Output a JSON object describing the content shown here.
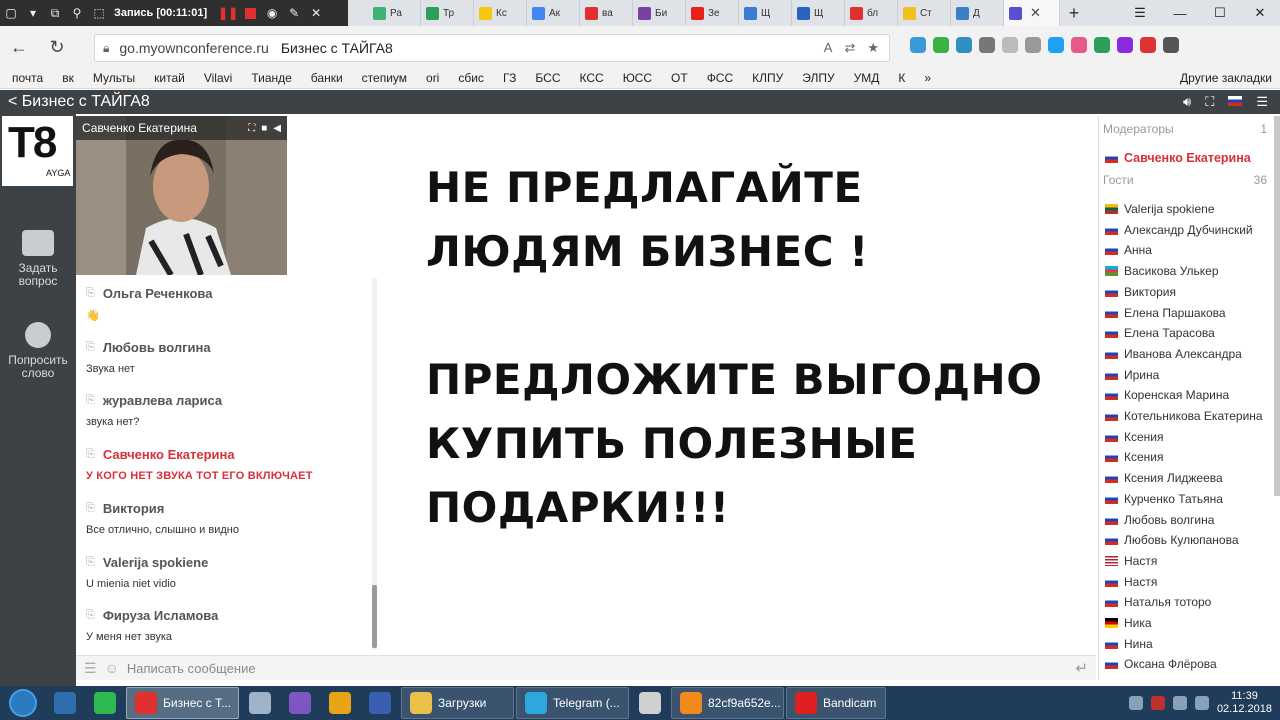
{
  "recorder": {
    "title": "Запись [00:11:01]"
  },
  "browser": {
    "tabs": [
      {
        "label": "Ра",
        "color": "#3cb371"
      },
      {
        "label": "Тр",
        "color": "#2e9e5b"
      },
      {
        "label": "Кс",
        "color": "#f2c811"
      },
      {
        "label": "Ак",
        "color": "#4285f4"
      },
      {
        "label": "ва",
        "color": "#e03030"
      },
      {
        "label": "Би",
        "color": "#7b3fa0"
      },
      {
        "label": "Зе",
        "color": "#e62117"
      },
      {
        "label": "Щ",
        "color": "#3a7bd5"
      },
      {
        "label": "Щ",
        "color": "#2a62c0"
      },
      {
        "label": "бл",
        "color": "#e03030"
      },
      {
        "label": "Ст",
        "color": "#f0c020"
      },
      {
        "label": "Д",
        "color": "#3a80c8"
      }
    ],
    "url_host": "go.myownconference.ru",
    "url_title": "Бизнес с ТАЙГА8",
    "bookmarks": [
      "почта",
      "вк",
      "Мульты",
      "китай",
      "Vilavi",
      "Тианде",
      "банки",
      "степиум",
      "ori",
      "сбис",
      "ГЗ",
      "БСС",
      "КСС",
      "ЮСС",
      "ОТ",
      "ФСС",
      "КЛПУ",
      "ЭЛПУ",
      "УМД",
      "К"
    ],
    "bookmarks_other": "Другие закладки"
  },
  "site": {
    "title": "Бизнес с ТАЙГА8",
    "logo_big": "T8",
    "logo_small": "AYGA",
    "rail": {
      "ask_label": "Задать вопрос",
      "speak_label": "Попросить слово"
    }
  },
  "video": {
    "presenter": "Савченко Екатерина"
  },
  "chat": {
    "messages": [
      {
        "author": "Ольга Реченкова",
        "text": "👋",
        "mod": false
      },
      {
        "author": "Любовь волгина",
        "text": "Звука нет",
        "mod": false
      },
      {
        "author": "журавлева лариса",
        "text": "звука нет?",
        "mod": false
      },
      {
        "author": "Савченко Екатерина",
        "text": "У КОГО НЕТ ЗВУКА ТОТ ЕГО ВКЛЮЧАЕТ",
        "mod": true
      },
      {
        "author": "Виктория",
        "text": "Все отлично, слышно и видно",
        "mod": false
      },
      {
        "author": "Valerija spokiene",
        "text": "U mienia niet vidio",
        "mod": false
      },
      {
        "author": "Фируза Исламова",
        "text": "У меня нет звука",
        "mod": false
      }
    ],
    "input_placeholder": "Написать сообщение"
  },
  "slide": {
    "line1": "НЕ ПРЕДЛАГАЙТЕ",
    "line2": "ЛЮДЯМ БИЗНЕС !",
    "line3": "ПРЕДЛОЖИТЕ ВЫГОДНО",
    "line4": "КУПИТЬ ПОЛЕЗНЫЕ",
    "line5": "ПОДАРКИ!!!"
  },
  "participants": {
    "moderators_label": "Модераторы",
    "moderators_count": "1",
    "moderator": {
      "name": "Савченко Екатерина",
      "flag": "ru"
    },
    "guests_label": "Гости",
    "guests_count": "36",
    "guests": [
      {
        "name": "Valerija spokiene",
        "flag": "lt"
      },
      {
        "name": "Александр Дубчинский",
        "flag": "ru"
      },
      {
        "name": "Анна",
        "flag": "ru"
      },
      {
        "name": "Васикова Улькер",
        "flag": "az"
      },
      {
        "name": "Виктория",
        "flag": "ru"
      },
      {
        "name": "Елена Паршакова",
        "flag": "ru"
      },
      {
        "name": "Елена Тарасова",
        "flag": "ru"
      },
      {
        "name": "Иванова Александра",
        "flag": "ru"
      },
      {
        "name": "Ирина",
        "flag": "ru"
      },
      {
        "name": "Коренская Марина",
        "flag": "ru"
      },
      {
        "name": "Котельникова Екатерина",
        "flag": "ru"
      },
      {
        "name": "Ксения",
        "flag": "ru"
      },
      {
        "name": "Ксения",
        "flag": "ru"
      },
      {
        "name": "Ксения Лиджеева",
        "flag": "ru"
      },
      {
        "name": "Курченко Татьяна",
        "flag": "ru"
      },
      {
        "name": "Любовь волгина",
        "flag": "ru"
      },
      {
        "name": "Любовь Кулюпанова",
        "flag": "ru"
      },
      {
        "name": "Настя",
        "flag": "us"
      },
      {
        "name": "Настя",
        "flag": "ru"
      },
      {
        "name": "Наталья тоторо",
        "flag": "ru"
      },
      {
        "name": "Ника",
        "flag": "de"
      },
      {
        "name": "Нина",
        "flag": "ru"
      },
      {
        "name": "Оксана Флёрова",
        "flag": "ru"
      }
    ]
  },
  "taskbar": {
    "items": [
      {
        "label": "",
        "color": "#2f6fb0"
      },
      {
        "label": "",
        "color": "#2dbb4f"
      },
      {
        "label": "Бизнес с Т...",
        "color": "#e03030",
        "active": true
      },
      {
        "label": "",
        "color": "#9fb3c8"
      },
      {
        "label": "",
        "color": "#7d56c2"
      },
      {
        "label": "",
        "color": "#e8a317"
      },
      {
        "label": "",
        "color": "#3a5fb0"
      },
      {
        "label": "Загрузки",
        "color": "#e8c04a"
      },
      {
        "label": "Telegram (...",
        "color": "#2ea6de"
      },
      {
        "label": "",
        "color": "#d0d0d0"
      },
      {
        "label": "82cf9a652e...",
        "color": "#f08a1c"
      },
      {
        "label": "Bandicam",
        "color": "#e02020"
      }
    ],
    "time": "11:39",
    "date": "02.12.2018"
  },
  "colors": {
    "accent_red": "#d7303a",
    "header_dark": "#3d4247",
    "taskbar": "#1f3c5a"
  }
}
